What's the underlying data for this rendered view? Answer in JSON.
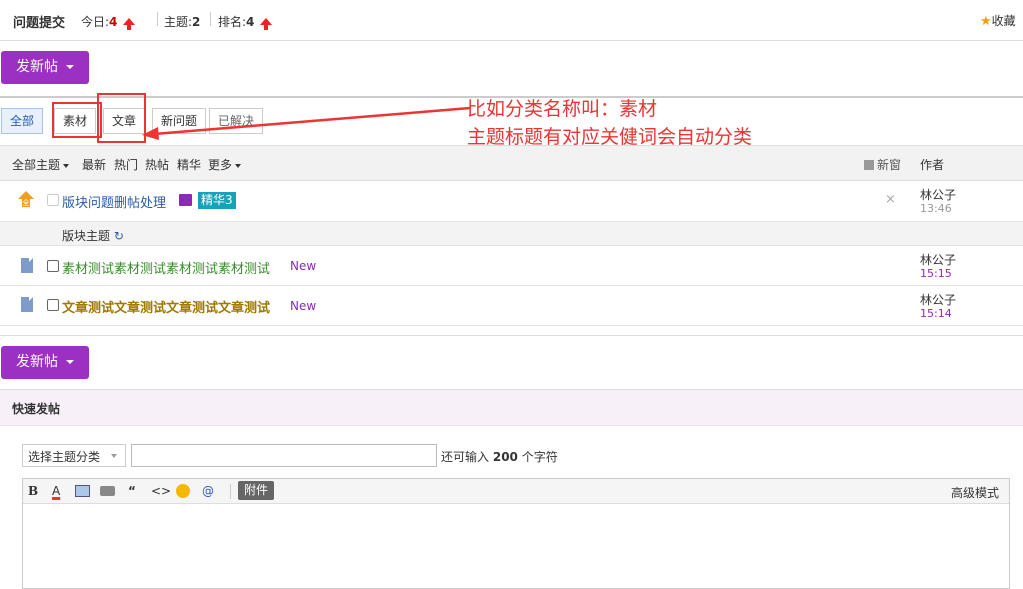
{
  "topbar": {
    "forum_name": "问题提交",
    "today_label": "今日:",
    "today_value": "4",
    "threads_label": "主题:",
    "threads_value": "2",
    "rank_label": "排名:",
    "rank_value": "4",
    "favorite_label": "收藏"
  },
  "new_post_label": "发新帖",
  "tabs": [
    {
      "label": "全部",
      "active": true
    },
    {
      "label": "素材",
      "active": false
    },
    {
      "label": "文章",
      "active": false
    },
    {
      "label": "新问题",
      "active": false
    },
    {
      "label": "已解决",
      "active": false
    }
  ],
  "annotation": {
    "line1": "比如分类名称叫：素材",
    "line2": "主题标题有对应关健词会自动分类",
    "color": "#e33333"
  },
  "list_header": {
    "all_threads": "全部主题",
    "latest": "最新",
    "hot": "热门",
    "hot_posts": "热帖",
    "digest": "精华",
    "more": "更多",
    "new_window": "新窗",
    "author": "作者"
  },
  "threads": {
    "sticky": {
      "title": "版块问题删帖处理",
      "badge": "精华3",
      "author": "林公子",
      "time": "13:46"
    },
    "section_label": "版块主题",
    "items": [
      {
        "title": "素材测试素材测试素材测试素材测试",
        "tag": "New",
        "author": "林公子",
        "time": "15:15",
        "color": "#3b8a2d"
      },
      {
        "title": "文章测试文章测试文章测试文章测试",
        "tag": "New",
        "author": "林公子",
        "time": "15:14",
        "color": "#a07800"
      }
    ]
  },
  "quick_post": {
    "header": "快速发帖",
    "category_select": "选择主题分类",
    "remaining_prefix": "还可输入",
    "remaining_count": "200",
    "remaining_suffix": "个字符",
    "attach_label": "附件",
    "advanced_mode": "高级模式"
  },
  "colors": {
    "accent_purple": "#9b30c2",
    "badge_teal": "#17a2b8",
    "red": "#e22222"
  }
}
